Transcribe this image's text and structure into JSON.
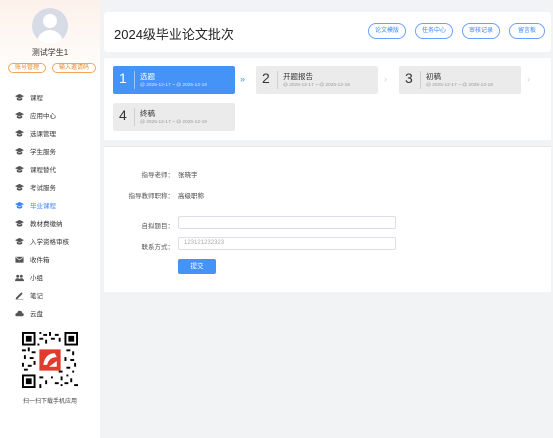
{
  "user": {
    "name": "测试学生1",
    "account_btn": "账号管理",
    "invite_btn": "输入邀请码"
  },
  "menu": [
    {
      "label": "课程",
      "icon": "graduation-cap-icon"
    },
    {
      "label": "应用中心",
      "icon": "graduation-cap-icon"
    },
    {
      "label": "选课管理",
      "icon": "graduation-cap-icon"
    },
    {
      "label": "学生服务",
      "icon": "graduation-cap-icon"
    },
    {
      "label": "课程替代",
      "icon": "graduation-cap-icon"
    },
    {
      "label": "考试服务",
      "icon": "graduation-cap-icon"
    },
    {
      "label": "毕业课程",
      "icon": "graduation-cap-icon",
      "active": true
    },
    {
      "label": "教材费缴纳",
      "icon": "graduation-cap-icon"
    },
    {
      "label": "入学资格审核",
      "icon": "graduation-cap-icon"
    },
    {
      "label": "收件箱",
      "icon": "inbox-icon"
    },
    {
      "label": "小组",
      "icon": "group-icon"
    },
    {
      "label": "笔记",
      "icon": "note-icon"
    },
    {
      "label": "云盘",
      "icon": "cloud-icon"
    }
  ],
  "qr_caption": "扫一扫下载手机应用",
  "header": {
    "title": "2024级毕业论文批次",
    "buttons": [
      "论文模版",
      "任务中心",
      "审核记录",
      "留言板"
    ]
  },
  "steps": [
    {
      "num": "1",
      "name": "选题",
      "date": "@ 2025-12-17 ~ @ 2025-12-19",
      "active": true
    },
    {
      "num": "2",
      "name": "开题报告",
      "date": "@ 2025-12-17 ~ @ 2025-12-19"
    },
    {
      "num": "3",
      "name": "初稿",
      "date": "@ 2025-12-17 ~ @ 2025-12-19"
    },
    {
      "num": "4",
      "name": "终稿",
      "date": "@ 2025-12-17 ~ @ 2025-12-19"
    }
  ],
  "form": {
    "advisor_label": "指导老师：",
    "advisor_value": "张晓宇",
    "title_label": "指导教师职称：",
    "title_value": "高级职称",
    "topic_label": "自拟题目：",
    "topic_value": "",
    "contact_label": "联系方式：",
    "contact_value": "123121232323",
    "submit_label": "提交"
  },
  "colors": {
    "accent": "#4593f7",
    "active_step": "#4593f7",
    "orange": "#e88a2a"
  }
}
